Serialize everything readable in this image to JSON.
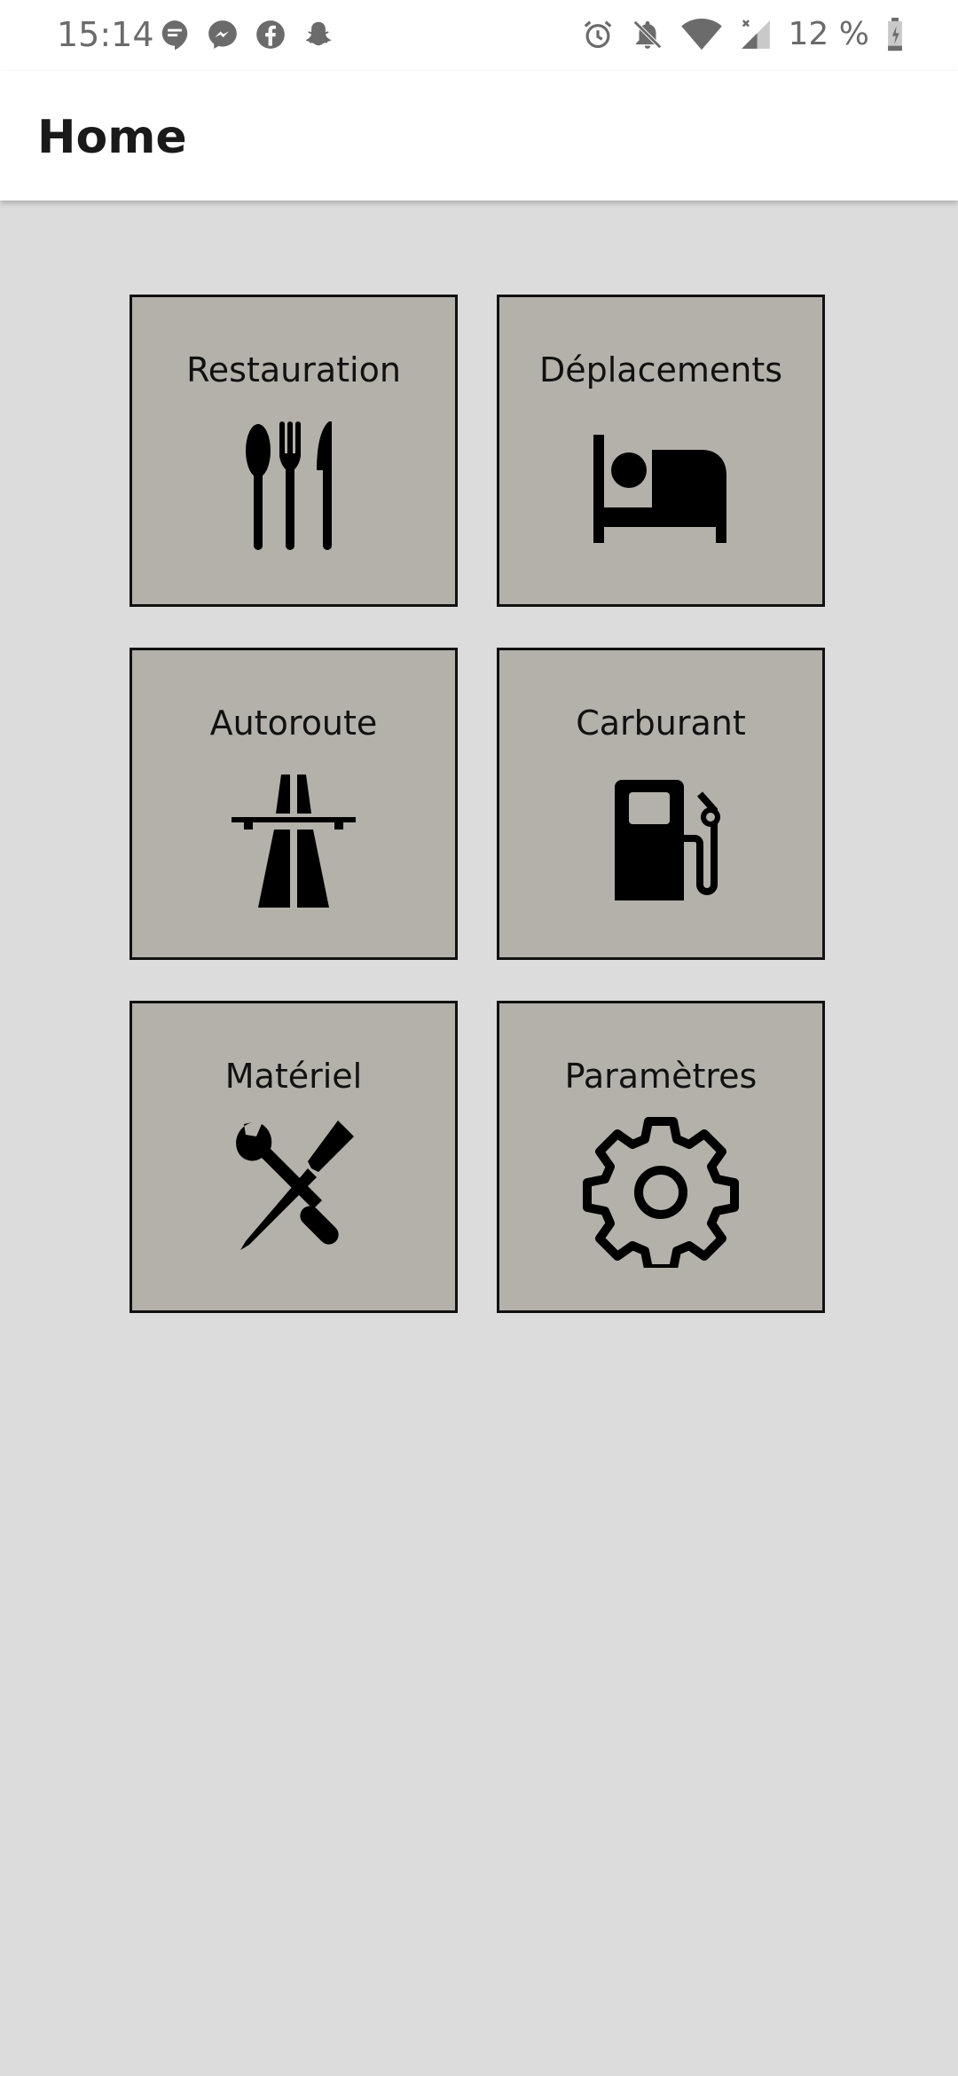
{
  "status_bar": {
    "time": "15:14",
    "battery_percent": "12 %",
    "left_icons": [
      "hangouts-icon",
      "messenger-icon",
      "facebook-icon",
      "snapchat-icon"
    ],
    "right_icons": [
      "alarm-icon",
      "notifications-off-icon",
      "wifi-icon",
      "cellular-signal-icon",
      "battery-icon"
    ]
  },
  "app_bar": {
    "title": "Home"
  },
  "tiles": [
    {
      "label": "Restauration",
      "icon": "cutlery-icon"
    },
    {
      "label": "Déplacements",
      "icon": "bed-icon"
    },
    {
      "label": "Autoroute",
      "icon": "highway-icon"
    },
    {
      "label": "Carburant",
      "icon": "fuel-pump-icon"
    },
    {
      "label": "Matériel",
      "icon": "tools-icon"
    },
    {
      "label": "Paramètres",
      "icon": "gear-icon"
    }
  ],
  "colors": {
    "background": "#dcdcdc",
    "tile_fill": "#b4b1ab",
    "tile_border": "#111111",
    "app_bar": "#ffffff"
  }
}
